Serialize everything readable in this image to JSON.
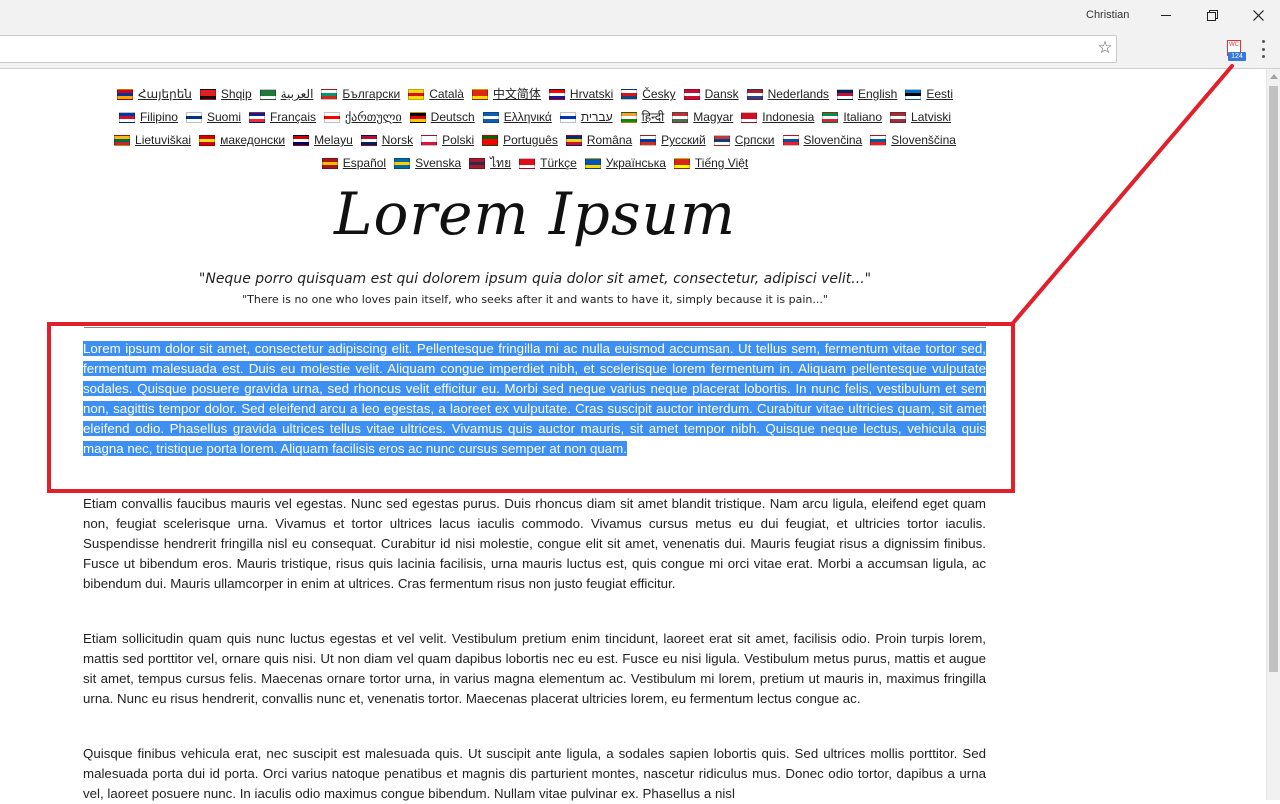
{
  "browser": {
    "profile_name": "Christian",
    "extension_badge": "124",
    "extension_icon_text": "WC",
    "icons": [
      "minimize-icon",
      "maximize-icon",
      "close-icon",
      "bookmark-star-icon",
      "extension-icon",
      "menu-icon"
    ]
  },
  "languages": [
    {
      "label": "Հայերեն",
      "flag": [
        "#d90012",
        "#0033a0",
        "#f2a800"
      ]
    },
    {
      "label": "Shqip",
      "flag": [
        "#e41e20",
        "#e41e20",
        "#111111"
      ]
    },
    {
      "label": "العربية",
      "flag": [
        "#1f7a3a",
        "#1f7a3a",
        "#ffffff"
      ]
    },
    {
      "label": "Български",
      "flag": [
        "#ffffff",
        "#00966e",
        "#d62612"
      ]
    },
    {
      "label": "Català",
      "flag": [
        "#fcdd09",
        "#da121a",
        "#fcdd09"
      ]
    },
    {
      "label": "中文简体",
      "flag": [
        "#de2910",
        "#de2910",
        "#ffde00"
      ]
    },
    {
      "label": "Hrvatski",
      "flag": [
        "#ff0000",
        "#ffffff",
        "#171796"
      ]
    },
    {
      "label": "Česky",
      "flag": [
        "#ffffff",
        "#d7141a",
        "#11457e"
      ]
    },
    {
      "label": "Dansk",
      "flag": [
        "#c60c30",
        "#ffffff",
        "#c60c30"
      ]
    },
    {
      "label": "Nederlands",
      "flag": [
        "#ae1c28",
        "#ffffff",
        "#21468b"
      ]
    },
    {
      "label": "English",
      "flag": [
        "#012169",
        "#c8102e",
        "#ffffff"
      ]
    },
    {
      "label": "Eesti",
      "flag": [
        "#0072ce",
        "#000000",
        "#ffffff"
      ]
    },
    {
      "label": "Filipino",
      "flag": [
        "#0038a8",
        "#ce1126",
        "#ffffff"
      ]
    },
    {
      "label": "Suomi",
      "flag": [
        "#ffffff",
        "#003580",
        "#ffffff"
      ]
    },
    {
      "label": "Français",
      "flag": [
        "#002395",
        "#ffffff",
        "#ed2939"
      ]
    },
    {
      "label": "ქართული",
      "flag": [
        "#ffffff",
        "#ff0000",
        "#ffffff"
      ]
    },
    {
      "label": "Deutsch",
      "flag": [
        "#000000",
        "#dd0000",
        "#ffce00"
      ]
    },
    {
      "label": "Ελληνικά",
      "flag": [
        "#0d5eaf",
        "#ffffff",
        "#0d5eaf"
      ]
    },
    {
      "label": "עברית",
      "flag": [
        "#ffffff",
        "#0038b8",
        "#ffffff"
      ]
    },
    {
      "label": "हिन्दी",
      "flag": [
        "#ff9933",
        "#ffffff",
        "#138808"
      ]
    },
    {
      "label": "Magyar",
      "flag": [
        "#ce2939",
        "#ffffff",
        "#477050"
      ]
    },
    {
      "label": "Indonesia",
      "flag": [
        "#ce1126",
        "#ce1126",
        "#ffffff"
      ]
    },
    {
      "label": "Italiano",
      "flag": [
        "#009246",
        "#ffffff",
        "#ce2b37"
      ]
    },
    {
      "label": "Latviski",
      "flag": [
        "#9e3039",
        "#ffffff",
        "#9e3039"
      ]
    },
    {
      "label": "Lietuviškai",
      "flag": [
        "#fdb913",
        "#006a44",
        "#c1272d"
      ]
    },
    {
      "label": "македонски",
      "flag": [
        "#d20000",
        "#ffe600",
        "#d20000"
      ]
    },
    {
      "label": "Melayu",
      "flag": [
        "#cc0001",
        "#ffffff",
        "#010066"
      ]
    },
    {
      "label": "Norsk",
      "flag": [
        "#ba0c2f",
        "#ffffff",
        "#00205b"
      ]
    },
    {
      "label": "Polski",
      "flag": [
        "#ffffff",
        "#ffffff",
        "#dc143c"
      ]
    },
    {
      "label": "Português",
      "flag": [
        "#006600",
        "#ff0000",
        "#ff0000"
      ]
    },
    {
      "label": "Româna",
      "flag": [
        "#002b7f",
        "#fcd116",
        "#ce1126"
      ]
    },
    {
      "label": "Русский",
      "flag": [
        "#ffffff",
        "#0039a6",
        "#d52b1e"
      ]
    },
    {
      "label": "Српски",
      "flag": [
        "#c6363c",
        "#0c4076",
        "#ffffff"
      ]
    },
    {
      "label": "Slovenčina",
      "flag": [
        "#ffffff",
        "#0b4ea2",
        "#ee1c25"
      ]
    },
    {
      "label": "Slovenščina",
      "flag": [
        "#ffffff",
        "#005da4",
        "#ed1c24"
      ]
    },
    {
      "label": "Español",
      "flag": [
        "#aa151b",
        "#f1bf00",
        "#aa151b"
      ]
    },
    {
      "label": "Svenska",
      "flag": [
        "#006aa7",
        "#fecc00",
        "#006aa7"
      ]
    },
    {
      "label": "ไทย",
      "flag": [
        "#a51931",
        "#2d2a4a",
        "#a51931"
      ]
    },
    {
      "label": "Türkçe",
      "flag": [
        "#e30a17",
        "#e30a17",
        "#ffffff"
      ]
    },
    {
      "label": "Українська",
      "flag": [
        "#0057b7",
        "#0057b7",
        "#ffd700"
      ]
    },
    {
      "label": "Tiếng Việt",
      "flag": [
        "#da251d",
        "#da251d",
        "#ffff00"
      ]
    }
  ],
  "page": {
    "logo": "Lorem Ipsum",
    "quote_latin": "\"Neque porro quisquam est qui dolorem ipsum quia dolor sit amet, consectetur, adipisci velit...\"",
    "quote_english": "\"There is no one who loves pain itself, who seeks after it and wants to have it, simply because it is pain...\"",
    "paragraphs": [
      "Lorem ipsum dolor sit amet, consectetur adipiscing elit. Pellentesque fringilla mi ac nulla euismod accumsan. Ut tellus sem, fermentum vitae tortor sed, fermentum malesuada est. Duis eu molestie velit. Aliquam congue imperdiet nibh, et scelerisque lorem fermentum in. Aliquam pellentesque vulputate sodales. Quisque posuere gravida urna, sed rhoncus velit efficitur eu. Morbi sed neque varius neque placerat lobortis. In nunc felis, vestibulum et sem non, sagittis tempor dolor. Sed eleifend arcu a leo egestas, a laoreet ex vulputate. Cras suscipit auctor interdum. Curabitur vitae ultricies quam, sit amet eleifend odio. Phasellus gravida ultrices tellus vitae ultrices. Vivamus quis auctor mauris, sit amet tempor nibh. Quisque neque lectus, vehicula quis magna nec, tristique porta lorem. Aliquam facilisis eros ac nunc cursus semper at non quam.",
      "Etiam convallis faucibus mauris vel egestas. Nunc sed egestas purus. Duis rhoncus diam sit amet blandit tristique. Nam arcu ligula, eleifend eget quam non, feugiat scelerisque urna. Vivamus et tortor ultrices lacus iaculis commodo. Vivamus cursus metus eu dui feugiat, et ultricies tortor iaculis. Suspendisse hendrerit fringilla nisl eu consequat. Curabitur id nisi molestie, congue elit sit amet, venenatis dui. Mauris feugiat risus a dignissim finibus. Fusce ut bibendum eros. Mauris tristique, risus quis lacinia facilisis, urna mauris luctus est, quis congue mi orci vitae erat. Morbi a accumsan ligula, ac bibendum dui. Mauris ullamcorper in enim at ultrices. Cras fermentum risus non justo feugiat efficitur.",
      "Etiam sollicitudin quam quis nunc luctus egestas et vel velit. Vestibulum pretium enim tincidunt, laoreet erat sit amet, facilisis odio. Proin turpis lorem, mattis sed porttitor vel, ornare quis nisi. Ut non diam vel quam dapibus lobortis nec eu est. Fusce eu nisi ligula. Vestibulum metus purus, mattis et augue sit amet, tempus cursus felis. Maecenas ornare tortor urna, in varius magna elementum ac. Vestibulum mi lorem, pretium ut mauris in, maximus fringilla urna. Nunc eu risus hendrerit, convallis nunc et, venenatis tortor. Maecenas placerat ultricies lorem, eu fermentum lectus congue ac.",
      "Quisque finibus vehicula erat, nec suscipit est malesuada quis. Ut suscipit ante ligula, a sodales sapien lobortis quis. Sed ultrices mollis porttitor. Sed malesuada porta dui id porta. Orci varius natoque penatibus et magnis dis parturient montes, nascetur ridiculus mus. Donec odio tortor, dapibus a urna vel, laoreet posuere nunc. In iaculis odio maximus congue bibendum. Nullam vitae pulvinar ex. Phasellus a nisl"
    ]
  },
  "colors": {
    "selection": "#3d8ff2",
    "annotation": "#e0202a",
    "extension_badge": "#3777d8"
  }
}
